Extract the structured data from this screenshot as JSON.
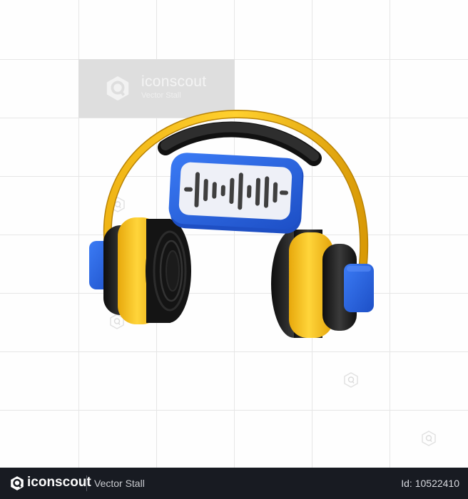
{
  "illustration": {
    "subject": "headphones-with-audio-waveform",
    "colors": {
      "headband": "#f2b81a",
      "headband_pad": "#2b2b2b",
      "ear_cup_yellow": "#f7c31e",
      "ear_cup_black": "#1e1e1e",
      "ear_connector_blue": "#2a64e6",
      "screen_frame_blue": "#2f6ee8",
      "screen_face": "#eef0f7",
      "waveform": "#3f3f3f"
    },
    "waveform_bar_levels": [
      0.15,
      0.95,
      0.6,
      0.45,
      0.3,
      0.7,
      1.0,
      0.35,
      0.75,
      0.85,
      0.55,
      0.15
    ]
  },
  "watermark": {
    "brand": "iconscout",
    "subtitle": "Vector Stall"
  },
  "footer": {
    "brand": "iconscout",
    "author": "Vector Stall",
    "asset_id": "Id: 10522410"
  }
}
